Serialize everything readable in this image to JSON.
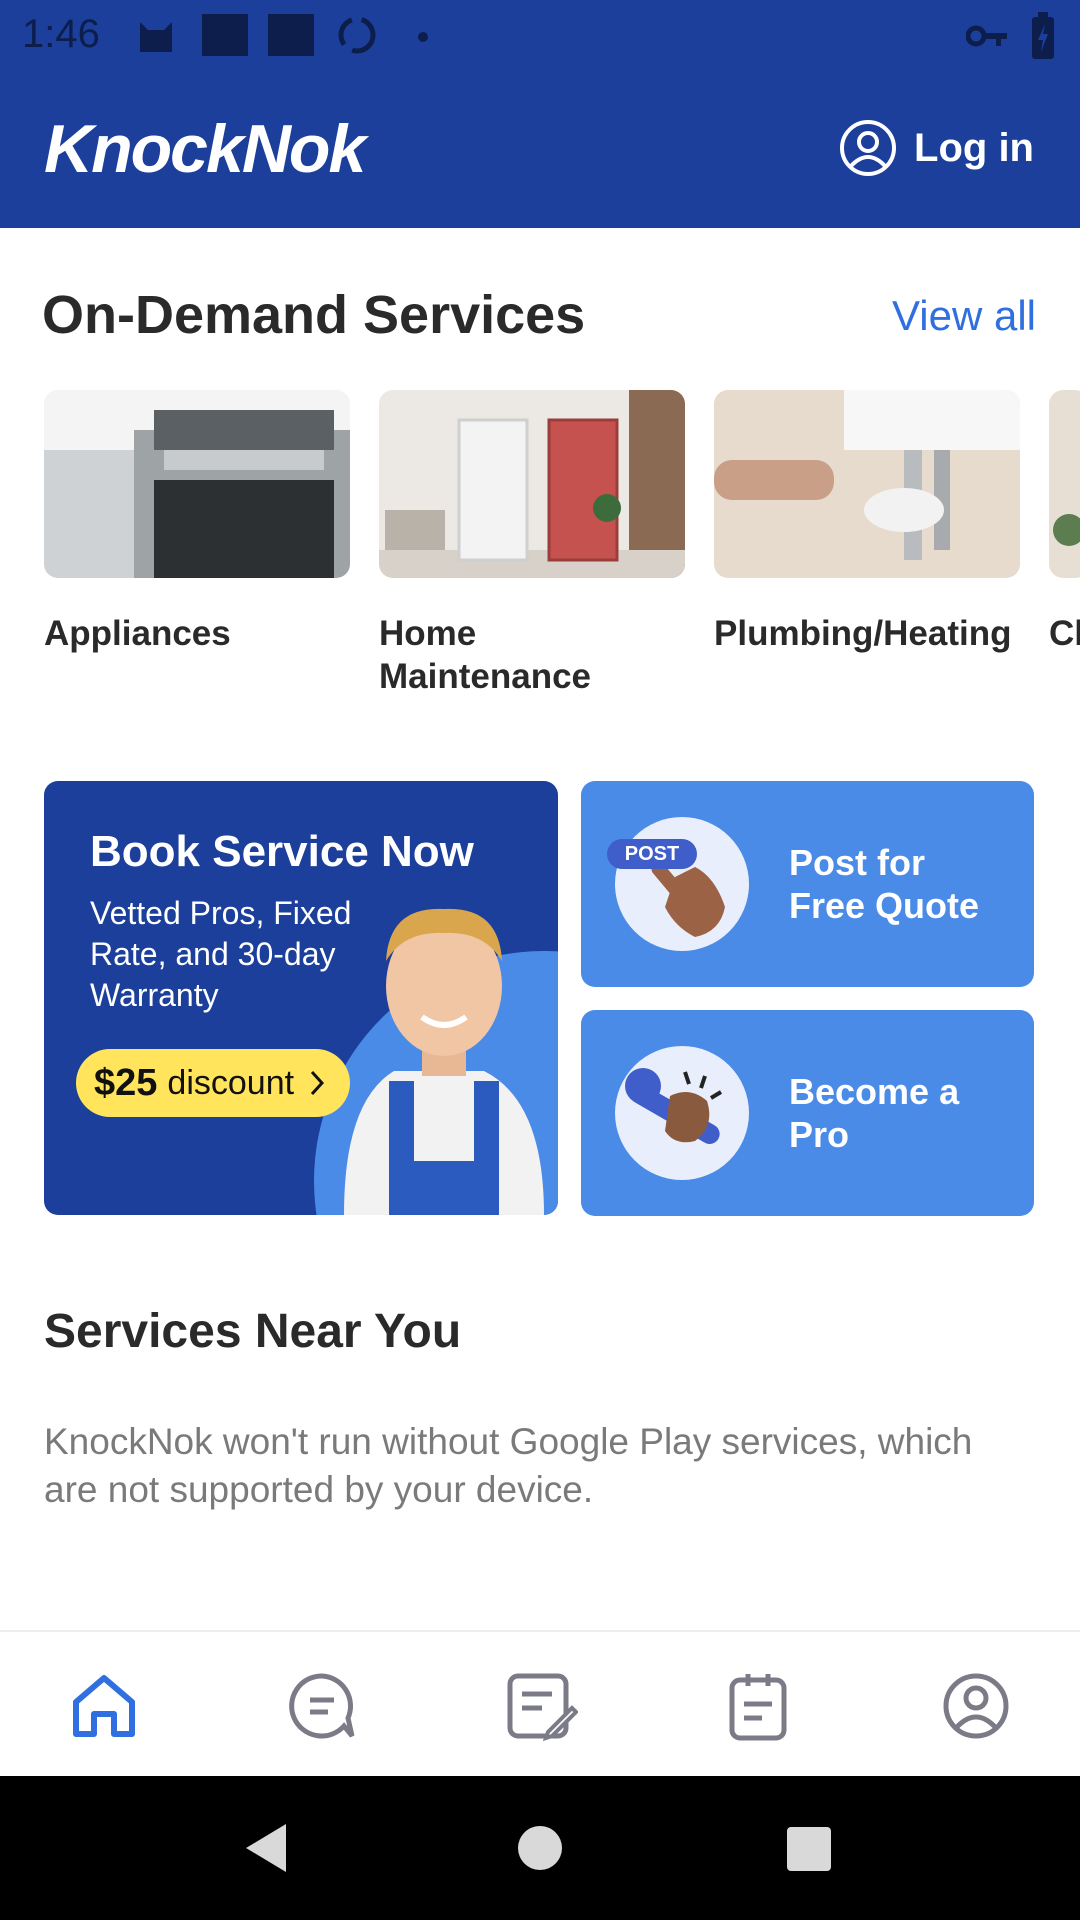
{
  "status_bar": {
    "time": "1:46"
  },
  "header": {
    "app_name": "KnockNok",
    "login_label": "Log in"
  },
  "on_demand": {
    "title": "On-Demand Services",
    "view_all": "View all",
    "categories": [
      {
        "label": "Appliances"
      },
      {
        "label": "Home\nMaintenance"
      },
      {
        "label": "Plumbing/Heating"
      },
      {
        "label": "Cl"
      }
    ]
  },
  "book_card": {
    "title": "Book Service Now",
    "subtitle": "Vetted Pros, Fixed Rate, and 30-day Warranty",
    "discount_amount": "$25",
    "discount_text": "discount"
  },
  "post_card": {
    "label": "Post for\nFree Quote",
    "badge": "POST"
  },
  "pro_card": {
    "label": "Become a\nPro"
  },
  "near_you": {
    "title": "Services Near You",
    "message": "KnockNok won't run without Google Play services, which are not supported by your device."
  },
  "colors": {
    "primary": "#1b3f9a",
    "accent": "#4a8be8",
    "link": "#2f6fe0",
    "discount": "#ffe45c"
  },
  "bottom_nav": [
    "home-icon",
    "chat-icon",
    "post-icon",
    "bookings-icon",
    "profile-icon"
  ]
}
